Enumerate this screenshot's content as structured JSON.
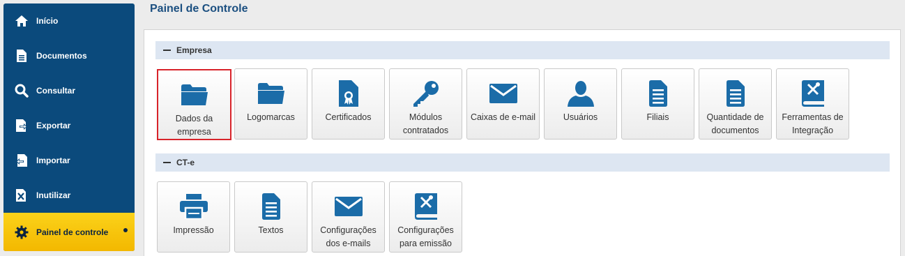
{
  "sidebar": {
    "items": [
      {
        "label": "Início",
        "icon": "home-icon"
      },
      {
        "label": "Documentos",
        "icon": "document-icon"
      },
      {
        "label": "Consultar",
        "icon": "search-icon"
      },
      {
        "label": "Exportar",
        "icon": "export-icon"
      },
      {
        "label": "Importar",
        "icon": "import-icon"
      },
      {
        "label": "Inutilizar",
        "icon": "void-document-icon"
      },
      {
        "label": "Painel de controle",
        "icon": "gear-icon",
        "active": true
      }
    ]
  },
  "header": {
    "title": "Painel de Controle"
  },
  "sections": [
    {
      "title": "Empresa",
      "tiles": [
        {
          "label": "Dados da empresa",
          "icon": "folder-icon",
          "selected": true
        },
        {
          "label": "Logomarcas",
          "icon": "folder-icon"
        },
        {
          "label": "Certificados",
          "icon": "certificate-icon"
        },
        {
          "label": "Módulos contratados",
          "icon": "key-icon"
        },
        {
          "label": "Caixas de e-mail",
          "icon": "envelope-icon"
        },
        {
          "label": "Usuários",
          "icon": "user-icon"
        },
        {
          "label": "Filiais",
          "icon": "file-text-icon"
        },
        {
          "label": "Quantidade de documentos",
          "icon": "file-text-icon"
        },
        {
          "label": "Ferramentas de Integração",
          "icon": "tools-book-icon"
        }
      ]
    },
    {
      "title": "CT-e",
      "tiles": [
        {
          "label": "Impressão",
          "icon": "printer-icon"
        },
        {
          "label": "Textos",
          "icon": "file-text-icon"
        },
        {
          "label": "Configurações dos e-mails",
          "icon": "envelope-icon"
        },
        {
          "label": "Configurações para emissão",
          "icon": "tools-book-icon"
        }
      ]
    }
  ],
  "colors": {
    "sidebar": "#0b4a7c",
    "active": "#f7c600",
    "icon": "#1b6ca8",
    "selected_border": "#d8232a",
    "section_bar": "#dde6f2"
  }
}
